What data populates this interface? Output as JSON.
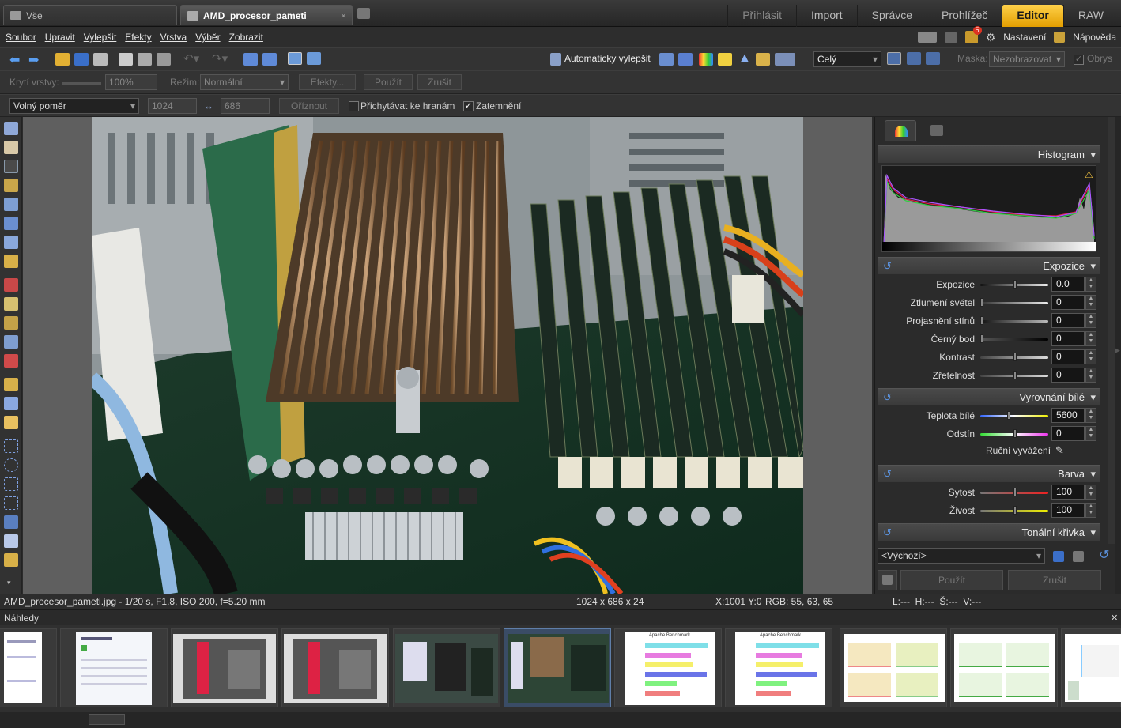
{
  "tabs": {
    "all_label": "Vše",
    "document_label": "AMD_procesor_pameti",
    "close_glyph": "×",
    "modes": [
      "Přihlásit",
      "Import",
      "Správce",
      "Prohlížeč",
      "Editor",
      "RAW"
    ]
  },
  "menu": {
    "items": [
      "Soubor",
      "Upravit",
      "Vylepšit",
      "Efekty",
      "Vrstva",
      "Výběr",
      "Zobrazit"
    ],
    "notification_count": "5",
    "settings_label": "Nastavení",
    "help_label": "Nápověda"
  },
  "toolbar1": {
    "auto_enhance_label": "Automaticky vylepšit",
    "zoom_select": "Celý",
    "mask_label": "Maska:",
    "mask_select": "Nezobrazovat",
    "outline_label": "Obrys"
  },
  "toolbar2": {
    "opacity_label": "Krytí vrstvy:",
    "opacity_value": "100%",
    "mode_label": "Režim:",
    "mode_value": "Normální",
    "effects_button": "Efekty...",
    "apply_button": "Použít",
    "cancel_button": "Zrušit"
  },
  "toolbar3": {
    "ratio_select": "Volný poměr",
    "width_value": "1024",
    "swap_glyph": "↔",
    "height_value": "686",
    "crop_button": "Oříznout",
    "snap_label": "Přichytávat ke hranám",
    "darken_label": "Zatemnění",
    "darken_checked": "✓"
  },
  "panel": {
    "histogram_title": "Histogram",
    "exposure_title": "Expozice",
    "exposure_rows": [
      {
        "label": "Expozice",
        "value": "0.0"
      },
      {
        "label": "Ztlumení světel",
        "value": "0"
      },
      {
        "label": "Projasnění stínů",
        "value": "0"
      },
      {
        "label": "Černý bod",
        "value": "0"
      },
      {
        "label": "Kontrast",
        "value": "0"
      },
      {
        "label": "Zřetelnost",
        "value": "0"
      }
    ],
    "wb_title": "Vyrovnání bílé",
    "wb_rows": [
      {
        "label": "Teplota bílé",
        "value": "5600"
      },
      {
        "label": "Odstín",
        "value": "0"
      }
    ],
    "manual_wb_label": "Ruční vyvážení",
    "color_title": "Barva",
    "color_rows": [
      {
        "label": "Sytost",
        "value": "100"
      },
      {
        "label": "Živost",
        "value": "100"
      }
    ],
    "tone_title": "Tonální křivka",
    "preset_select": "<Výchozí>",
    "apply_button": "Použít",
    "cancel_button": "Zrušit"
  },
  "status": {
    "file_info": "AMD_procesor_pameti.jpg - 1/20 s, F1.8, ISO 200, f=5.20 mm",
    "dimensions": "1024 x 686 x 24",
    "coords": "X:1001 Y:0",
    "rgb": "RGB: 55, 63, 65",
    "lhs": "L:---  H:---  Š:---  V:---"
  },
  "thumbnails": {
    "title": "Náhledy",
    "close_glyph": "×",
    "chart_title": "Apache Benchmark"
  },
  "colors": {
    "accent": "#f0b000",
    "bar_colors": [
      "#7fdfe8",
      "#e77be0",
      "#f5ef6a",
      "#6a74e8",
      "#7ff17f",
      "#f07e7e"
    ]
  }
}
